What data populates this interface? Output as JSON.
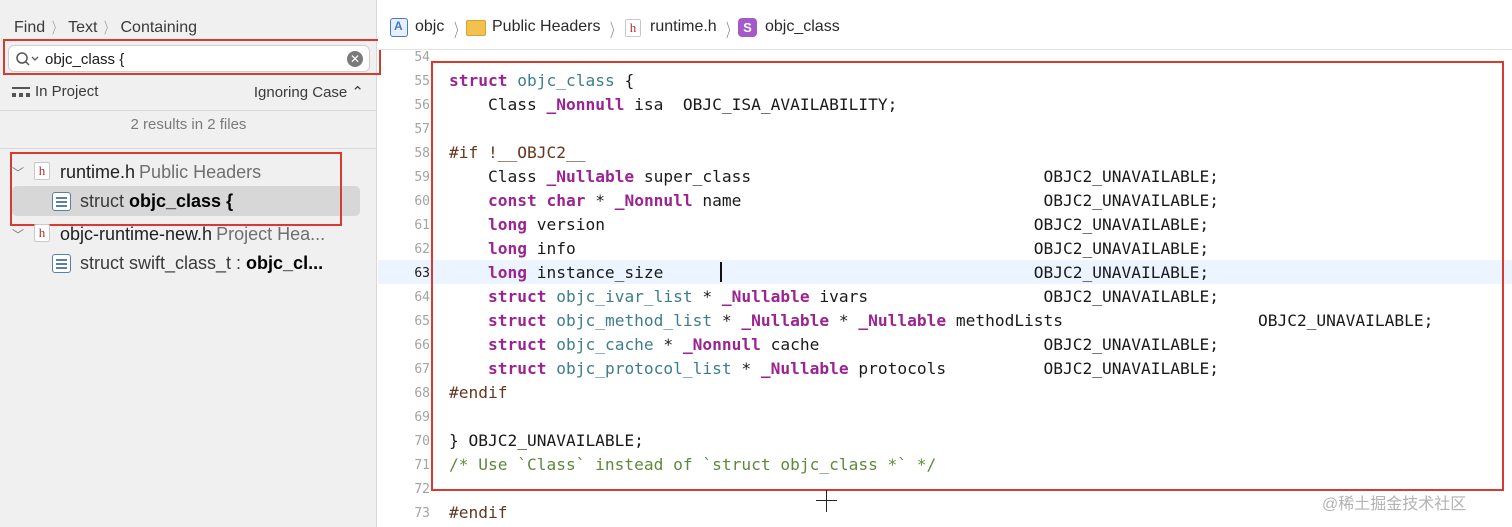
{
  "find_bar": {
    "find": "Find",
    "text": "Text",
    "containing": "Containing"
  },
  "search": {
    "value": "objc_class {",
    "placeholder": ""
  },
  "scope": {
    "label": "In Project",
    "case": "Ignoring Case ⌃"
  },
  "results_summary": "2 results in 2 files",
  "results": [
    {
      "file": "runtime.h",
      "path": "Public Headers",
      "matches": [
        {
          "prefix": "struct ",
          "match": "objc_class {"
        }
      ]
    },
    {
      "file": "objc-runtime-new.h",
      "path": "Project Hea...",
      "matches": [
        {
          "prefix": "struct swift_class_t : ",
          "match": "objc_cl..."
        }
      ]
    }
  ],
  "breadcrumb": [
    "objc",
    "Public Headers",
    "runtime.h",
    "objc_class"
  ],
  "gutter": [
    "54",
    "55",
    "56",
    "57",
    "58",
    "59",
    "60",
    "61",
    "62",
    "63",
    "64",
    "65",
    "66",
    "67",
    "68",
    "69",
    "70",
    "71",
    "72",
    "73"
  ],
  "current_line": "63",
  "code_text": {
    "l71": "/* Use `Class` instead of `struct objc_class *` */",
    "l70": "} OBJC2_UNAVAILABLE;"
  },
  "watermark": "@稀土掘金技术社区",
  "colors": {
    "highlight_box": "#d93a2f",
    "keyword": "#9b2393",
    "type": "#3e7d8c",
    "comment": "#5d8a3a"
  }
}
